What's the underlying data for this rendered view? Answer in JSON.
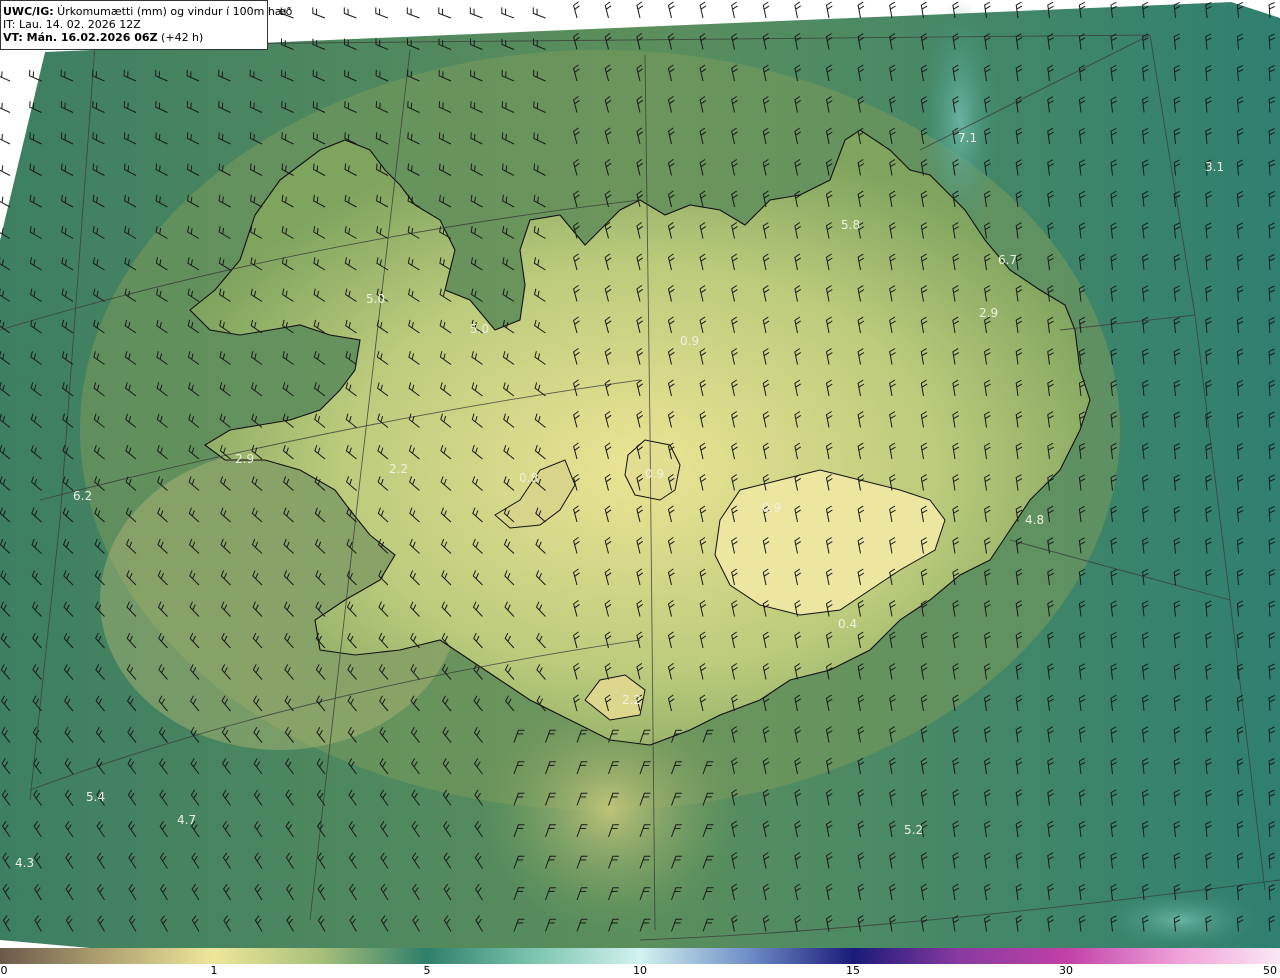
{
  "info": {
    "title_code": "UWC/IG:",
    "title_desc": " Úrkomumætti (mm) og vindur í 100m hæð",
    "it": "IT: Lau. 14. 02. 2026 12Z",
    "vt_label": "VT: Mán. 16.02.2026 06Z",
    "vt_extra": " (+42 h)"
  },
  "point_values": [
    "7.1",
    "3.1",
    "5.8",
    "6.7",
    "2.9",
    "5.0",
    "5.0",
    "6.2",
    "4.8",
    "5.4",
    "4.7",
    "4.3",
    "5.2",
    "2.9",
    "2.2",
    "0.9",
    "0.9",
    "0.9",
    "0.8",
    "0.4",
    "2.2"
  ],
  "colorbar": {
    "ticks": [
      "0",
      "1",
      "5",
      "10",
      "15",
      "30",
      "50"
    ],
    "stops": [
      {
        "v": 0.0,
        "c": "#6a5a4a"
      },
      {
        "v": 0.08,
        "c": "#b0a070"
      },
      {
        "v": 0.167,
        "c": "#eee79a"
      },
      {
        "v": 0.25,
        "c": "#a8c07a"
      },
      {
        "v": 0.333,
        "c": "#2f7f6a"
      },
      {
        "v": 0.42,
        "c": "#7fc7b0"
      },
      {
        "v": 0.5,
        "c": "#d2f2ef"
      },
      {
        "v": 0.583,
        "c": "#7090c8"
      },
      {
        "v": 0.667,
        "c": "#1a1a78"
      },
      {
        "v": 0.75,
        "c": "#8a3aa0"
      },
      {
        "v": 0.833,
        "c": "#c040a8"
      },
      {
        "v": 0.92,
        "c": "#f0a0d8"
      },
      {
        "v": 1.0,
        "c": "#fbe8f4"
      }
    ]
  },
  "colors": {
    "sea": "#2f7563",
    "land_low": "#7d9a5a",
    "land_high": "#e3df8e",
    "coast": "#111111",
    "barb": "#1a1a1a"
  }
}
